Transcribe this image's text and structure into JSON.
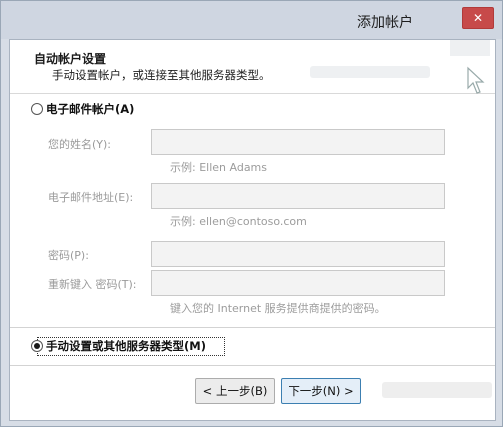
{
  "window": {
    "title": "添加帐户",
    "close_symbol": "✕"
  },
  "header": {
    "title": "自动帐户设置",
    "subtitle": "手动设置帐户，或连接至其他服务器类型。"
  },
  "email_option": {
    "label": "电子邮件帐户(A)",
    "selected": false,
    "fields": {
      "name_label": "您的姓名(Y):",
      "name_example": "示例: Ellen Adams",
      "email_label": "电子邮件地址(E):",
      "email_example": "示例: ellen@contoso.com",
      "password_label": "密码(P):",
      "retype_label": "重新键入 密码(T):",
      "password_hint": "键入您的 Internet 服务提供商提供的密码。"
    }
  },
  "manual_option": {
    "label": "手动设置或其他服务器类型(M)",
    "selected": true
  },
  "buttons": {
    "back": "< 上一步(B)",
    "next": "下一步(N) >"
  }
}
